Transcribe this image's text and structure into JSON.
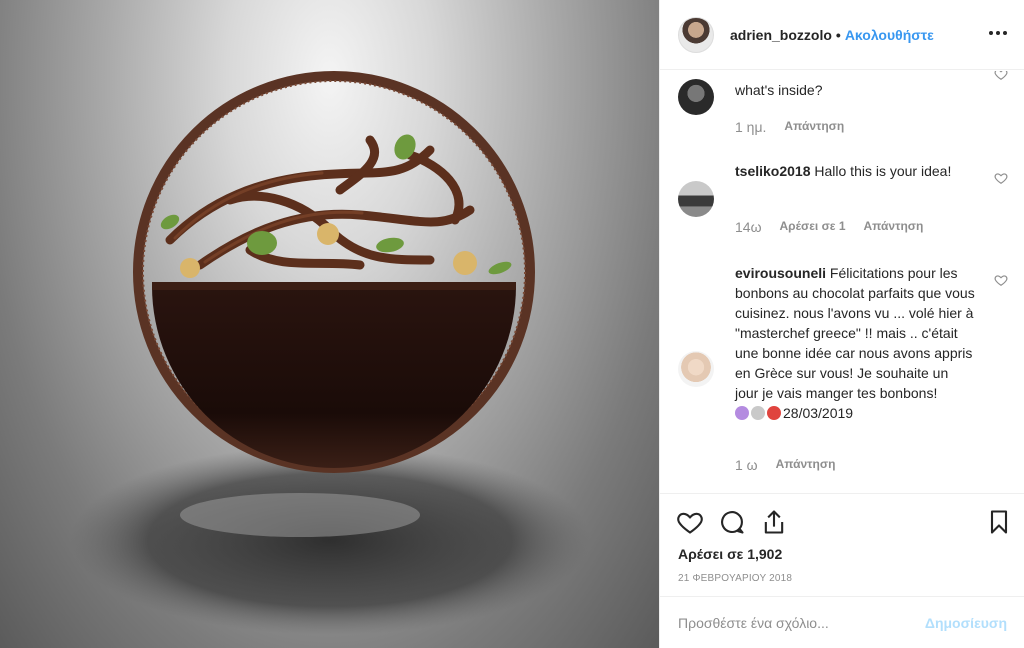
{
  "post": {
    "photo_icon": "chocolate-dessert-photo"
  },
  "header": {
    "username": "adrien_bozzolo",
    "separator": "•",
    "follow_label": "Ακολουθήστε",
    "more_icon": "more-options-icon"
  },
  "comments": [
    {
      "username": "",
      "text": "what's inside?",
      "time": "1 ημ.",
      "likes": "",
      "reply_label": "Απάντηση"
    },
    {
      "username": "tseliko2018",
      "text": "Hallo this is your idea!",
      "time": "14ω",
      "likes": "Αρέσει σε 1",
      "reply_label": "Απάντηση"
    },
    {
      "username": "evirousouneli",
      "text": "Félicitations pour les bonbons au chocolat parfaits que vous cuisinez. nous l'avons vu ... volé hier à \"masterchef greece\" !! mais .. c'était une bonne idée car nous avons appris en Grèce sur vous! Je souhaite un jour je vais manger tes bonbons!",
      "text_tail": "28/03/2019",
      "emojis": [
        "woman-emoji",
        "magnifier-emoji",
        "pin-emoji"
      ],
      "time": "1 ω",
      "likes": "",
      "reply_label": "Απάντηση"
    }
  ],
  "actions": {
    "likes_count": "Αρέσει σε 1,902",
    "date": "21 ΦΕΒΡΟΥΑΡΙΟΥ 2018"
  },
  "add_comment": {
    "placeholder": "Προσθέστε ένα σχόλιο...",
    "post_label": "Δημοσίευση"
  },
  "colors": {
    "link_blue": "#3897f0",
    "post_disabled": "#b2dffc",
    "muted": "#8e8e8e",
    "text": "#262626"
  }
}
